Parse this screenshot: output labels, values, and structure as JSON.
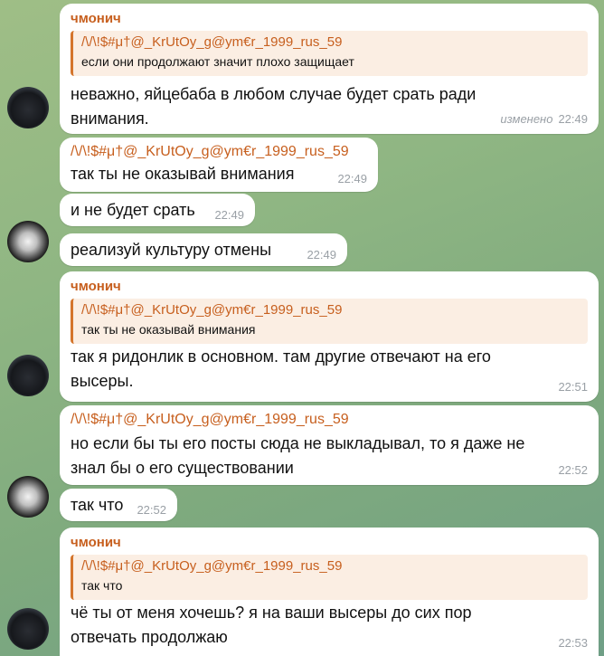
{
  "messages": [
    {
      "sender": "чмонич",
      "quote": {
        "name": "/\\/\\!$#μ†@_KrUtOy_g@ym€r_1999_rus_59",
        "text": "если они продолжают значит плохо защищает"
      },
      "lines": [
        "неважно, яйцебаба в любом случае будет срать ради",
        "внимания."
      ],
      "edited": "изменено",
      "time": "22:49"
    },
    {
      "forward_name": "/\\/\\!$#μ†@_KrUtOy_g@ym€r_1999_rus_59",
      "text": "так ты не оказывай внимания",
      "time": "22:49"
    },
    {
      "text": "и не будет срать",
      "time": "22:49"
    },
    {
      "text": "реализуй культуру отмены",
      "time": "22:49"
    },
    {
      "sender": "чмонич",
      "quote": {
        "name": "/\\/\\!$#μ†@_KrUtOy_g@ym€r_1999_rus_59",
        "text": "так ты не оказывай внимания"
      },
      "lines": [
        "так я ридонлик в основном. там другие отвечают на его",
        "высеры."
      ],
      "time": "22:51"
    },
    {
      "forward_name": "/\\/\\!$#μ†@_KrUtOy_g@ym€r_1999_rus_59",
      "lines": [
        "но если бы ты его посты сюда не выкладывал, то я даже не",
        "знал бы о его существовании"
      ],
      "time": "22:52"
    },
    {
      "text": "так что",
      "time": "22:52"
    },
    {
      "sender": "чмонич",
      "quote": {
        "name": "/\\/\\!$#μ†@_KrUtOy_g@ym€r_1999_rus_59",
        "text": "так что"
      },
      "lines": [
        "чё ты от меня хочешь? я на ваши высеры до сих пор",
        "отвечать продолжаю"
      ],
      "time": "22:53"
    }
  ]
}
